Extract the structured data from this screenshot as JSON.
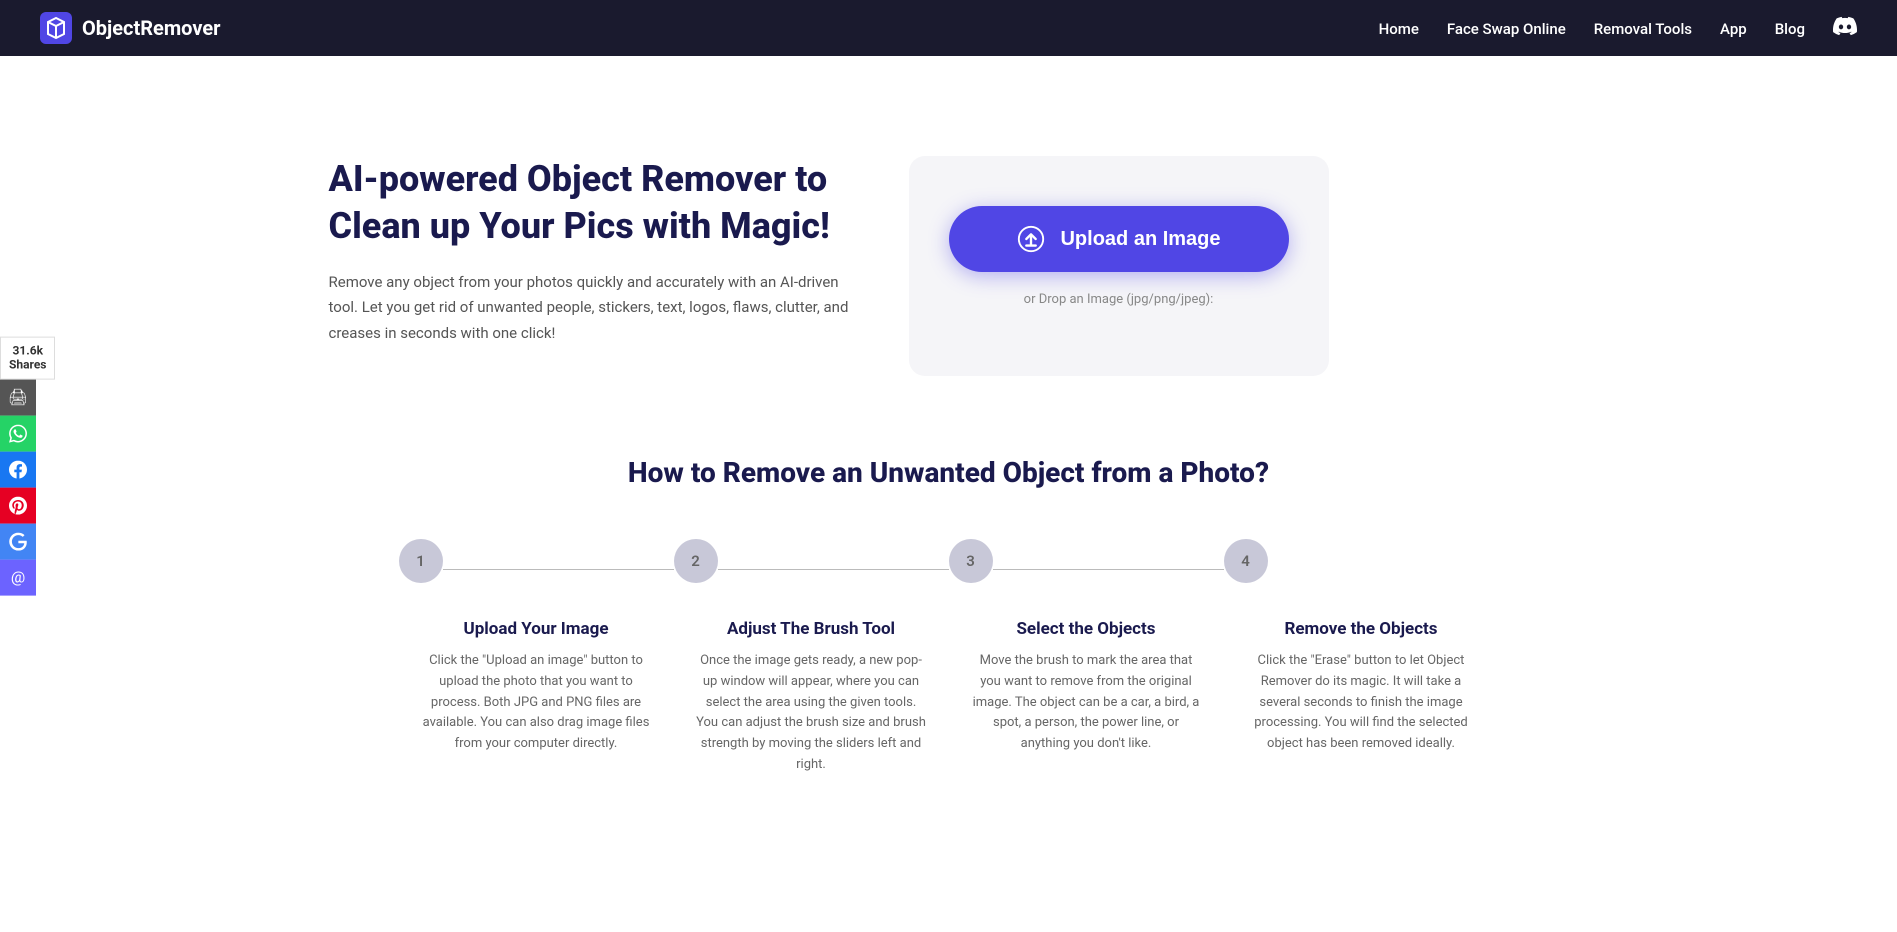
{
  "nav": {
    "logo_text": "ObjectRemover",
    "links": [
      {
        "label": "Home",
        "id": "home"
      },
      {
        "label": "Face Swap Online",
        "id": "face-swap"
      },
      {
        "label": "Removal Tools",
        "id": "removal-tools"
      },
      {
        "label": "App",
        "id": "app"
      },
      {
        "label": "Blog",
        "id": "blog"
      }
    ]
  },
  "social": {
    "count": "31.6k",
    "shares_label": "Shares",
    "buttons": [
      {
        "id": "print",
        "icon": "🖨",
        "color": "#555"
      },
      {
        "id": "whatsapp",
        "icon": "W",
        "color": "#25d366"
      },
      {
        "id": "facebook",
        "icon": "f",
        "color": "#1877f2"
      },
      {
        "id": "pinterest",
        "icon": "P",
        "color": "#e60023"
      },
      {
        "id": "google",
        "icon": "G",
        "color": "#4285f4"
      },
      {
        "id": "email",
        "icon": "@",
        "color": "#6c63ff"
      }
    ]
  },
  "hero": {
    "title": "AI-powered Object Remover to Clean up Your Pics with Magic!",
    "description": "Remove any object from your photos quickly and accurately with an AI-driven tool. Let you get rid of unwanted people, stickers, text, logos, flaws, clutter, and creases in seconds with one click!"
  },
  "upload": {
    "button_label": "Upload an Image",
    "drop_hint": "or Drop an Image (jpg/png/jpeg):"
  },
  "how_to": {
    "title": "How to Remove an Unwanted Object from a Photo?",
    "steps": [
      {
        "number": "1",
        "title": "Upload Your Image",
        "description": "Click the \"Upload an image\" button to upload the photo that you want to process. Both JPG and PNG files are available. You can also drag image files from your computer directly."
      },
      {
        "number": "2",
        "title": "Adjust The Brush Tool",
        "description": "Once the image gets ready, a new pop-up window will appear, where you can select the area using the given tools. You can adjust the brush size and brush strength by moving the sliders left and right."
      },
      {
        "number": "3",
        "title": "Select the Objects",
        "description": "Move the brush to mark the area that you want to remove from the original image. The object can be a car, a bird, a spot, a person, the power line, or anything you don't like."
      },
      {
        "number": "4",
        "title": "Remove the Objects",
        "description": "Click the \"Erase\" button to let Object Remover do its magic. It will take a several seconds to finish the image processing. You will find the selected object has been removed ideally."
      }
    ]
  }
}
